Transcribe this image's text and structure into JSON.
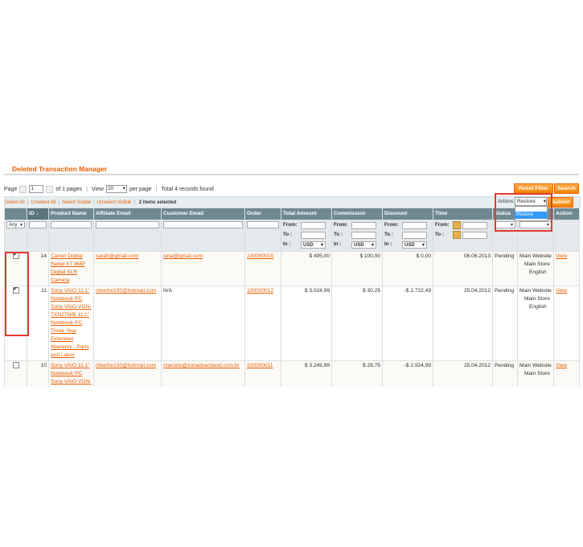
{
  "title": "Deleted Transaction Manager",
  "pager": {
    "page_label": "Page",
    "page_value": "1",
    "of_pages": "of 1 pages",
    "view_label": "View",
    "view_value": "20",
    "per_page": "per page",
    "total": "Total 4 records found"
  },
  "buttons": {
    "reset_filter": "Reset Filter",
    "search": "Search",
    "submit": "Submit"
  },
  "massaction": {
    "select_all": "Select All",
    "unselect_all": "Unselect All",
    "select_visible": "Select Visible",
    "unselect_visible": "Unselect Visible",
    "separator": "|",
    "items_selected": "2 items selected",
    "actions_label": "Actions",
    "selected_action": "Restore",
    "dropdown_option": "Restore"
  },
  "columns": [
    "",
    "ID",
    "Product Name",
    "Affiliate Email",
    "Customer Email",
    "Order",
    "Total Amount",
    "Commission",
    "Discount",
    "Time",
    "Status",
    "Action"
  ],
  "filters": {
    "any": "Any",
    "from": "From:",
    "to": "To :",
    "in": "In :",
    "currency": "USD",
    "time_from": "From:",
    "time_to": "To :"
  },
  "rows": [
    {
      "checked": true,
      "id": "14",
      "product": "Canon Digital Rebel XT 8MP Digital SLR Camera",
      "affiliate": "sarah@gmail.com",
      "customer": "luna@gmail.com",
      "order": "100000015",
      "total": "$ 495,00",
      "commission": "$ 100,00",
      "discount": "$ 0,00",
      "time": "06.06.2013",
      "status": "Pending",
      "website": "Main Website",
      "store": "Main Store",
      "lang": "English",
      "action": "View"
    },
    {
      "checked": true,
      "id": "11",
      "product": "Sony VAIO 11.1\" Notebook PC Sony VAIO VGN-TXN27N/B 11.1\" Notebook PC Three Year Extended Warranty - Parts and Labor",
      "affiliate": "nhenhe100@hotmail.com",
      "customer": "N/A",
      "order": "100000012",
      "total": "$ 3.024,99",
      "commission": "$ 30,25",
      "discount": "-$ 2.722,49",
      "time": "25.04.2012",
      "status": "Pending",
      "website": "Main Website",
      "store": "Main Store",
      "lang": "English",
      "action": "View"
    },
    {
      "checked": false,
      "id": "10",
      "product": "Sony VAIO 11.1\" Notebook PC Sony VAIO VGN-",
      "affiliate": "nhenhe100@hotmail.com",
      "customer": "marcelo@zonadownlaod.com.br",
      "order": "100000011",
      "total": "$ 3.249,99",
      "commission": "$ 29,75",
      "discount": "-$ 2.924,99",
      "time": "25.04.2012",
      "status": "Pending",
      "website": "Main Website",
      "store": "Main Store",
      "lang": "",
      "action": "View"
    }
  ],
  "colors": {
    "accent": "#eb5e00",
    "header_bg": "#6f8992",
    "highlight": "#e23b2e",
    "button": "#f18200"
  }
}
